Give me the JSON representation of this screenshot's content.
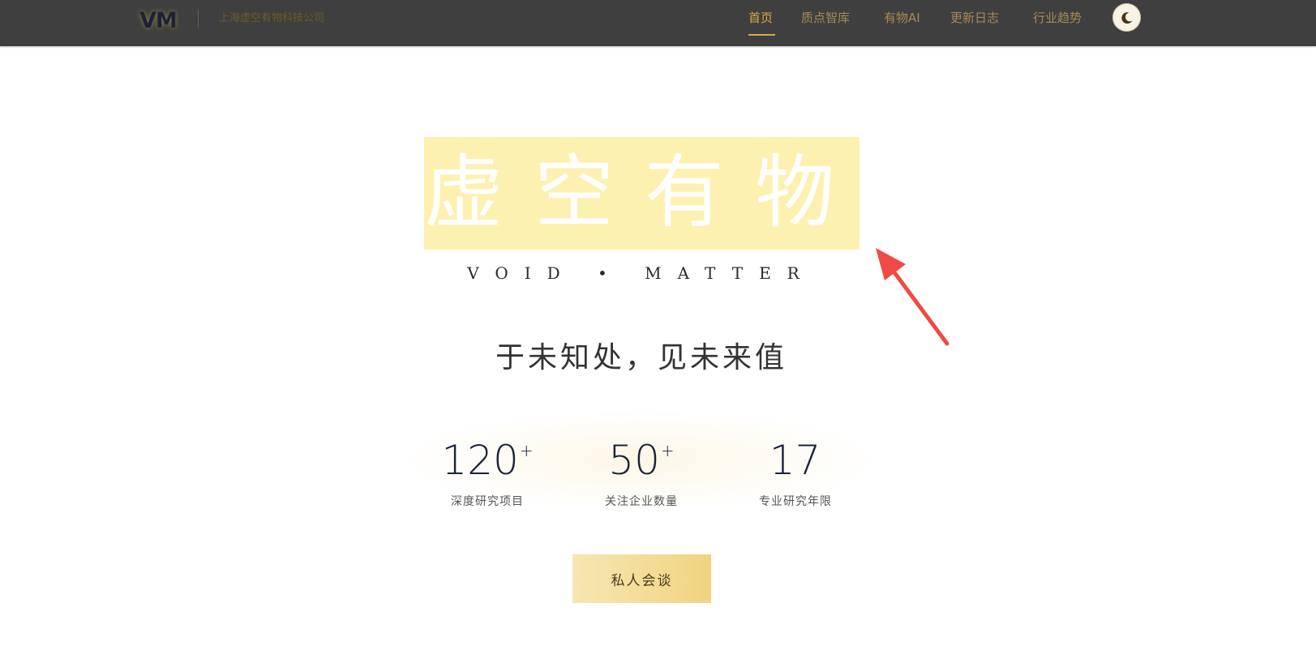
{
  "header": {
    "logo": "VM",
    "company": "上海虚空有物科技公司",
    "nav": [
      {
        "label": "首页",
        "active": true
      },
      {
        "label": "质点智库",
        "active": false
      },
      {
        "label": "有物AI",
        "active": false
      },
      {
        "label": "更新日志",
        "active": false
      },
      {
        "label": "行业趋势",
        "active": false
      }
    ],
    "theme_icon": "moon-icon"
  },
  "hero": {
    "title": "虚空有物",
    "subtitle": "VOID • MATTER",
    "slogan": "于未知处，见未来值"
  },
  "stats": [
    {
      "value": "120",
      "suffix": "+",
      "label": "深度研究项目"
    },
    {
      "value": "50",
      "suffix": "+",
      "label": "关注企业数量"
    },
    {
      "value": "17",
      "suffix": "",
      "label": "专业研究年限"
    }
  ],
  "cta": {
    "label": "私人会谈"
  },
  "colors": {
    "header_bg": "#3f3f3f",
    "accent": "#d9a94a",
    "nav_text": "#a8895a",
    "title_highlight": "#fdf1b1",
    "arrow": "#ef4a43"
  }
}
